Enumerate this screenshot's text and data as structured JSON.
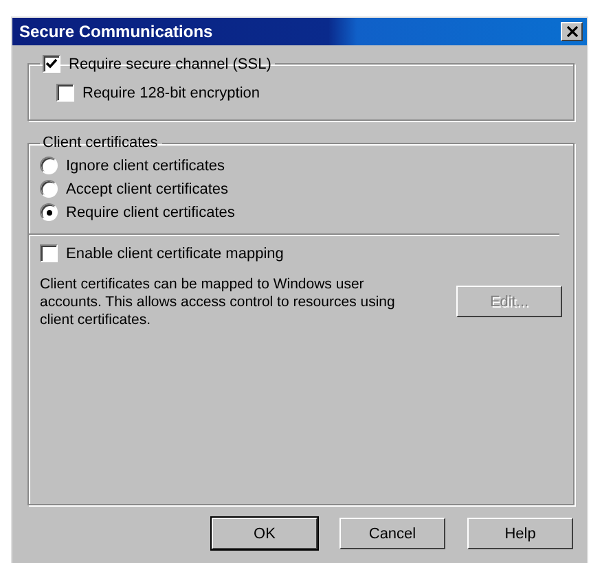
{
  "window": {
    "title": "Secure Communications"
  },
  "secure_channel": {
    "label": "Require secure channel (SSL)",
    "checked": true
  },
  "encryption": {
    "label": "Require 128-bit encryption",
    "checked": false
  },
  "client_certificates": {
    "title": "Client certificates",
    "options": [
      {
        "label": "Ignore client certificates",
        "selected": false
      },
      {
        "label": "Accept client certificates",
        "selected": false
      },
      {
        "label": "Require client certificates",
        "selected": true
      }
    ],
    "mapping": {
      "label": "Enable client certificate mapping",
      "checked": false
    },
    "description": "Client certificates can be mapped to Windows user accounts.  This allows access control to resources using client certificates.",
    "edit_button": {
      "label": "Edit...",
      "disabled": true
    }
  },
  "buttons": [
    {
      "label": "OK",
      "default": true
    },
    {
      "label": "Cancel",
      "default": false
    },
    {
      "label": "Help",
      "default": false
    }
  ]
}
